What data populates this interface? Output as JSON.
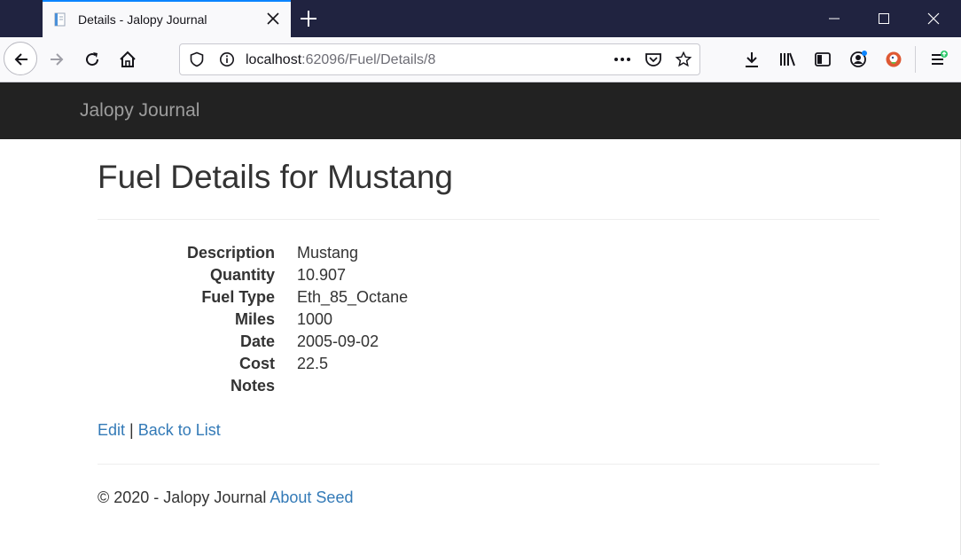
{
  "browser": {
    "tab_title": "Details - Jalopy Journal",
    "url_host": "localhost",
    "url_path": ":62096/Fuel/Details/8"
  },
  "site": {
    "brand": "Jalopy Journal"
  },
  "page": {
    "title": "Fuel Details for Mustang",
    "fields": [
      {
        "label": "Description",
        "value": "Mustang"
      },
      {
        "label": "Quantity",
        "value": "10.907"
      },
      {
        "label": "Fuel Type",
        "value": "Eth_85_Octane"
      },
      {
        "label": "Miles",
        "value": "1000"
      },
      {
        "label": "Date",
        "value": "2005-09-02"
      },
      {
        "label": "Cost",
        "value": "22.5"
      },
      {
        "label": "Notes",
        "value": ""
      }
    ],
    "edit_label": "Edit",
    "separator": "|",
    "back_label": "Back to List"
  },
  "footer": {
    "copyright": "© 2020 - Jalopy Journal",
    "about_label": "About Seed"
  },
  "colors": {
    "titlebar": "#202340",
    "site_nav": "#222222",
    "link": "#337ab7",
    "tab_accent": "#0a84ff"
  }
}
